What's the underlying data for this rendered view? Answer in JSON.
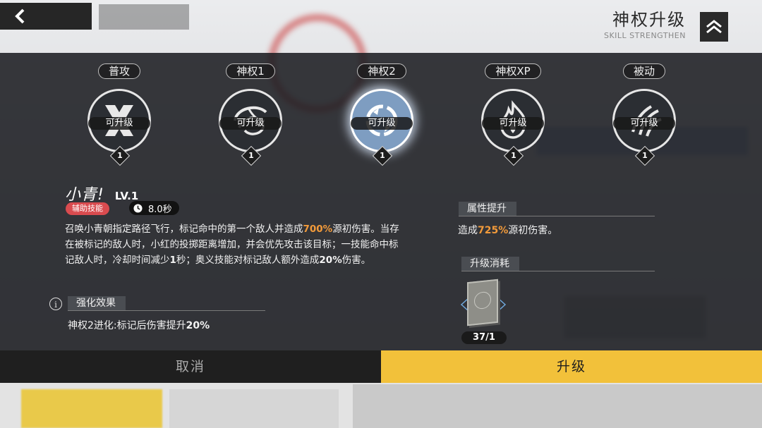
{
  "header": {
    "title": "神权升级",
    "subtitle": "SKILL STRENGTHEN"
  },
  "skills": [
    {
      "name": "普攻",
      "status": "可升级",
      "level": "1",
      "icon": "crossed-blades-icon"
    },
    {
      "name": "神权1",
      "status": "可升级",
      "level": "1",
      "icon": "serpent-swirl-icon"
    },
    {
      "name": "神权2",
      "status": "可升级",
      "level": "1",
      "icon": "snake-ring-icon"
    },
    {
      "name": "神权XP",
      "status": "可升级",
      "level": "1",
      "icon": "flame-icon"
    },
    {
      "name": "被动",
      "status": "可升级",
      "level": "1",
      "icon": "claw-slash-icon"
    }
  ],
  "selected_skill_index": 2,
  "detail": {
    "name": "小青!",
    "level": "LV.1",
    "tag": "辅助技能",
    "cooldown": "8.0秒",
    "description_parts": [
      {
        "text": "召唤小青朝指定路径飞行，标记命中的第一个敌人并造成"
      },
      {
        "text": "700%",
        "style": "hl"
      },
      {
        "text": "源初伤害。当存在被标记的敌人时，小红的投掷距离增加，并会优先攻击该目标；一技能命中标记敌人时，冷却时间减少"
      },
      {
        "text": "1",
        "style": "bold"
      },
      {
        "text": "秒；奥义技能对标记敌人额外造成"
      },
      {
        "text": "20%",
        "style": "bold"
      },
      {
        "text": "伤害。"
      }
    ],
    "enhance_header": "强化效果",
    "enhance_text_prefix": "神权2进化:标记后伤害提升",
    "enhance_text_value": "20%"
  },
  "attributes": {
    "header": "属性提升",
    "text_prefix": "造成",
    "value": "725%",
    "text_suffix": "源初伤害。"
  },
  "cost": {
    "header": "升级消耗",
    "item_icon": "skill-book-icon",
    "count": "37/1"
  },
  "buttons": {
    "cancel": "取消",
    "upgrade": "升级"
  },
  "colors": {
    "accent_yellow": "#f2c13a",
    "highlight_orange": "#f29a3a",
    "tag_red": "#d94b4f",
    "selected_blue": "#7e9dc1"
  }
}
